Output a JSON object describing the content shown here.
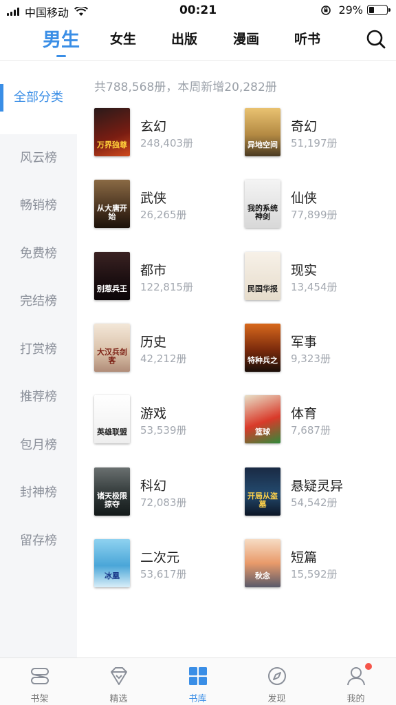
{
  "status_bar": {
    "carrier": "中国移动",
    "time": "00:21",
    "battery_pct": "29%",
    "battery_level": 0.29,
    "icons": [
      "signal-icon",
      "wifi-icon",
      "rotation-lock-icon",
      "battery-icon"
    ]
  },
  "top_nav": {
    "tabs": [
      {
        "label": "男生",
        "active": true
      },
      {
        "label": "女生",
        "active": false
      },
      {
        "label": "出版",
        "active": false
      },
      {
        "label": "漫画",
        "active": false
      },
      {
        "label": "听书",
        "active": false
      }
    ],
    "search_icon": "search-icon",
    "accent_color": "#3a8ee6"
  },
  "sidebar": {
    "items": [
      {
        "label": "全部分类",
        "active": true
      },
      {
        "label": "风云榜"
      },
      {
        "label": "畅销榜"
      },
      {
        "label": "免费榜"
      },
      {
        "label": "完结榜"
      },
      {
        "label": "打赏榜"
      },
      {
        "label": "推荐榜"
      },
      {
        "label": "包月榜"
      },
      {
        "label": "封神榜"
      },
      {
        "label": "留存榜"
      }
    ]
  },
  "summary": "共788,568册，本周新增20,282册",
  "categories": [
    {
      "name": "玄幻",
      "count": "248,403册",
      "cover_text": "万界独尊"
    },
    {
      "name": "奇幻",
      "count": "51,197册",
      "cover_text": "异地空间"
    },
    {
      "name": "武侠",
      "count": "26,265册",
      "cover_text": "从大唐开始"
    },
    {
      "name": "仙侠",
      "count": "77,899册",
      "cover_text": "我的系统神剑"
    },
    {
      "name": "都市",
      "count": "122,815册",
      "cover_text": "别惹兵王"
    },
    {
      "name": "现实",
      "count": "13,454册",
      "cover_text": "民国华报"
    },
    {
      "name": "历史",
      "count": "42,212册",
      "cover_text": "大汉兵剑客"
    },
    {
      "name": "军事",
      "count": "9,323册",
      "cover_text": "特种兵之"
    },
    {
      "name": "游戏",
      "count": "53,539册",
      "cover_text": "英雄联盟"
    },
    {
      "name": "体育",
      "count": "7,687册",
      "cover_text": "篮球"
    },
    {
      "name": "科幻",
      "count": "72,083册",
      "cover_text": "诸天极限掠夺"
    },
    {
      "name": "悬疑灵异",
      "count": "54,542册",
      "cover_text": "开局从盗墓"
    },
    {
      "name": "二次元",
      "count": "53,617册",
      "cover_text": "冰凰"
    },
    {
      "name": "短篇",
      "count": "15,592册",
      "cover_text": "秋念"
    }
  ],
  "bottom_tabs": [
    {
      "label": "书架",
      "icon": "bookshelf-icon",
      "active": false
    },
    {
      "label": "精选",
      "icon": "diamond-icon",
      "active": false
    },
    {
      "label": "书库",
      "icon": "grid-icon",
      "active": true
    },
    {
      "label": "发现",
      "icon": "compass-icon",
      "active": false
    },
    {
      "label": "我的",
      "icon": "user-icon",
      "active": false,
      "badge": "red-dot"
    }
  ]
}
